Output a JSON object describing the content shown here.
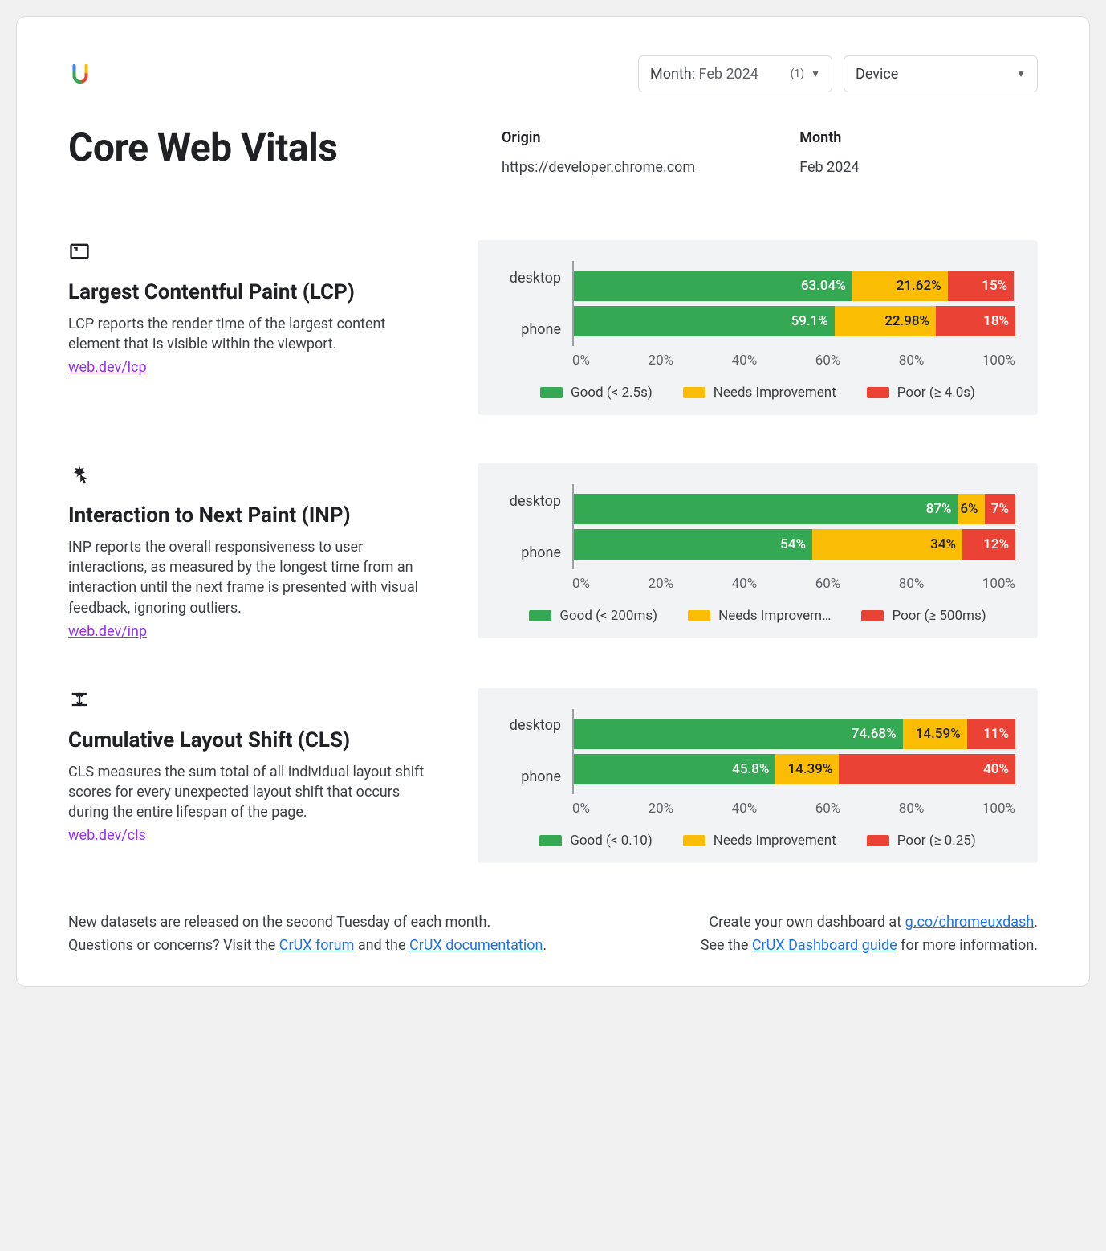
{
  "selectors": {
    "month_label": "Month:",
    "month_value": " Feb 2024",
    "month_count": "(1)",
    "device_label": "Device"
  },
  "header": {
    "title": "Core Web Vitals",
    "origin_label": "Origin",
    "origin_value": "https://developer.chrome.com",
    "month_label": "Month",
    "month_value": "Feb 2024"
  },
  "axis_ticks": [
    "0%",
    "20%",
    "40%",
    "60%",
    "80%",
    "100%"
  ],
  "metrics": [
    {
      "key": "lcp",
      "title": "Largest Contentful Paint (LCP)",
      "desc": "LCP reports the render time of the largest content element that is visible within the viewport.",
      "link": "web.dev/lcp",
      "legend": {
        "good": "Good (< 2.5s)",
        "needs": "Needs Improvement",
        "poor": "Poor (≥ 4.0s)"
      },
      "rows": [
        {
          "label": "desktop",
          "good": 63.04,
          "needs": 21.62,
          "poor": 15,
          "good_txt": "63.04%",
          "needs_txt": "21.62%",
          "poor_txt": "15%"
        },
        {
          "label": "phone",
          "good": 59.1,
          "needs": 22.98,
          "poor": 18,
          "good_txt": "59.1%",
          "needs_txt": "22.98%",
          "poor_txt": "18%"
        }
      ]
    },
    {
      "key": "inp",
      "title": "Interaction to Next Paint (INP)",
      "desc": "INP reports the overall responsiveness to user interactions, as measured by the longest time from an interaction until the next frame is presented with visual feedback, ignoring outliers.",
      "link": "web.dev/inp",
      "legend": {
        "good": "Good (< 200ms)",
        "needs": "Needs Improvem…",
        "poor": "Poor (≥ 500ms)"
      },
      "rows": [
        {
          "label": "desktop",
          "good": 87,
          "needs": 6,
          "poor": 7,
          "good_txt": "87%",
          "needs_txt": "6%",
          "poor_txt": "7%"
        },
        {
          "label": "phone",
          "good": 54,
          "needs": 34,
          "poor": 12,
          "good_txt": "54%",
          "needs_txt": "34%",
          "poor_txt": "12%"
        }
      ]
    },
    {
      "key": "cls",
      "title": "Cumulative Layout Shift (CLS)",
      "desc": "CLS measures the sum total of all individual layout shift scores for every unexpected layout shift that occurs during the entire lifespan of the page.",
      "link": "web.dev/cls",
      "legend": {
        "good": "Good (< 0.10)",
        "needs": "Needs Improvement",
        "poor": "Poor (≥ 0.25)"
      },
      "rows": [
        {
          "label": "desktop",
          "good": 74.68,
          "needs": 14.59,
          "poor": 11,
          "good_txt": "74.68%",
          "needs_txt": "14.59%",
          "poor_txt": "11%"
        },
        {
          "label": "phone",
          "good": 45.8,
          "needs": 14.39,
          "poor": 40,
          "good_txt": "45.8%",
          "needs_txt": "14.39%",
          "poor_txt": "40%"
        }
      ]
    }
  ],
  "footer": {
    "left_line1": "New datasets are released on the second Tuesday of each month.",
    "left_q": "Questions or concerns? Visit the ",
    "left_link1": "CrUX forum",
    "left_mid": " and the ",
    "left_link2": "CrUX documentation",
    "left_end": ".",
    "right_pre": "Create your own dashboard at ",
    "right_link1": "g.co/chromeuxdash",
    "right_mid": ".",
    "right_line2_pre": "See the ",
    "right_link2": "CrUX Dashboard guide",
    "right_line2_post": " for more information."
  },
  "chart_data": [
    {
      "type": "bar",
      "title": "Largest Contentful Paint (LCP)",
      "categories": [
        "desktop",
        "phone"
      ],
      "series": [
        {
          "name": "Good (< 2.5s)",
          "values": [
            63.04,
            59.1
          ]
        },
        {
          "name": "Needs Improvement",
          "values": [
            21.62,
            22.98
          ]
        },
        {
          "name": "Poor (≥ 4.0s)",
          "values": [
            15,
            18
          ]
        }
      ],
      "xlabel": "",
      "ylabel": "",
      "xlim": [
        0,
        100
      ],
      "stacked": true,
      "orientation": "horizontal"
    },
    {
      "type": "bar",
      "title": "Interaction to Next Paint (INP)",
      "categories": [
        "desktop",
        "phone"
      ],
      "series": [
        {
          "name": "Good (< 200ms)",
          "values": [
            87,
            54
          ]
        },
        {
          "name": "Needs Improvement",
          "values": [
            6,
            34
          ]
        },
        {
          "name": "Poor (≥ 500ms)",
          "values": [
            7,
            12
          ]
        }
      ],
      "xlabel": "",
      "ylabel": "",
      "xlim": [
        0,
        100
      ],
      "stacked": true,
      "orientation": "horizontal"
    },
    {
      "type": "bar",
      "title": "Cumulative Layout Shift (CLS)",
      "categories": [
        "desktop",
        "phone"
      ],
      "series": [
        {
          "name": "Good (< 0.10)",
          "values": [
            74.68,
            45.8
          ]
        },
        {
          "name": "Needs Improvement",
          "values": [
            14.59,
            14.39
          ]
        },
        {
          "name": "Poor (≥ 0.25)",
          "values": [
            11,
            40
          ]
        }
      ],
      "xlabel": "",
      "ylabel": "",
      "xlim": [
        0,
        100
      ],
      "stacked": true,
      "orientation": "horizontal"
    }
  ]
}
